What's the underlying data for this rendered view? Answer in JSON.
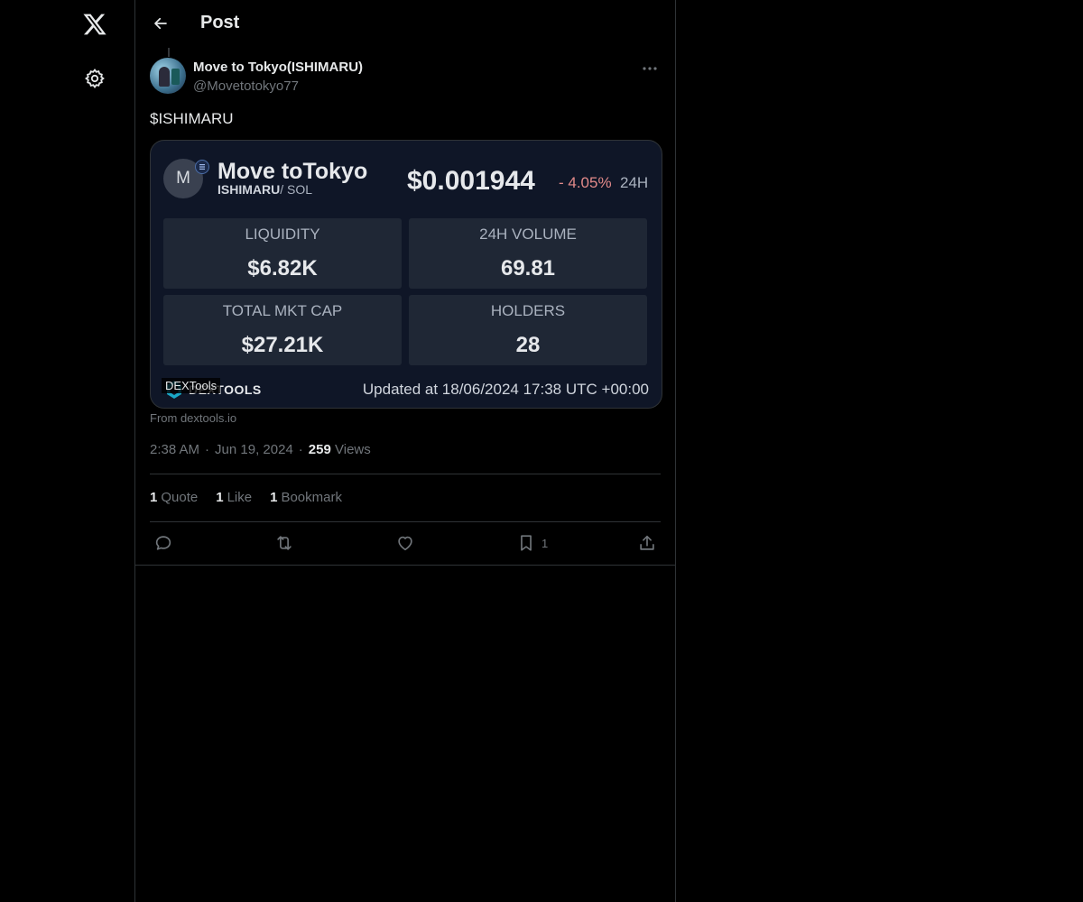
{
  "nav": {
    "logo_icon": "x-logo-icon",
    "settings_icon": "gear-icon"
  },
  "header": {
    "title": "Post",
    "back_icon": "arrow-left-icon"
  },
  "post": {
    "author_name": "Move to Tokyo(ISHIMARU)",
    "author_handle": "@Movetotokyo77",
    "text": "$ISHIMARU",
    "card": {
      "coin_initial": "M",
      "coin_name": "Move toTokyo",
      "pair_base": "ISHIMARU",
      "pair_quote": "/ SOL",
      "price": "$0.001944",
      "change": "- 4.05%",
      "period": "24H",
      "stats": [
        {
          "label": "LIQUIDITY",
          "value": "$6.82K"
        },
        {
          "label": "24H VOLUME",
          "value": "69.81"
        },
        {
          "label": "TOTAL MKT CAP",
          "value": "$27.21K"
        },
        {
          "label": "HOLDERS",
          "value": "28"
        }
      ],
      "brand_word": "DEXTOOLS",
      "brand_alt": "DEXTools",
      "updated": "Updated at 18/06/2024 17:38 UTC +00:00"
    },
    "card_source": "From dextools.io",
    "meta": {
      "time": "2:38 AM",
      "date": "Jun 19, 2024",
      "views_count": "259",
      "views_label": "Views"
    },
    "engagement": {
      "quotes_count": "1",
      "quotes_label": "Quote",
      "likes_count": "1",
      "likes_label": "Like",
      "bookmarks_count": "1",
      "bookmarks_label": "Bookmark"
    },
    "actions": {
      "bookmark_count": "1"
    }
  },
  "colors": {
    "background": "#000000",
    "border": "#2f3336",
    "text": "#e7e9ea",
    "muted": "#71767b",
    "card_bg": "#0f1627",
    "stat_bg": "#1f2735",
    "negative": "#e28a8a"
  }
}
